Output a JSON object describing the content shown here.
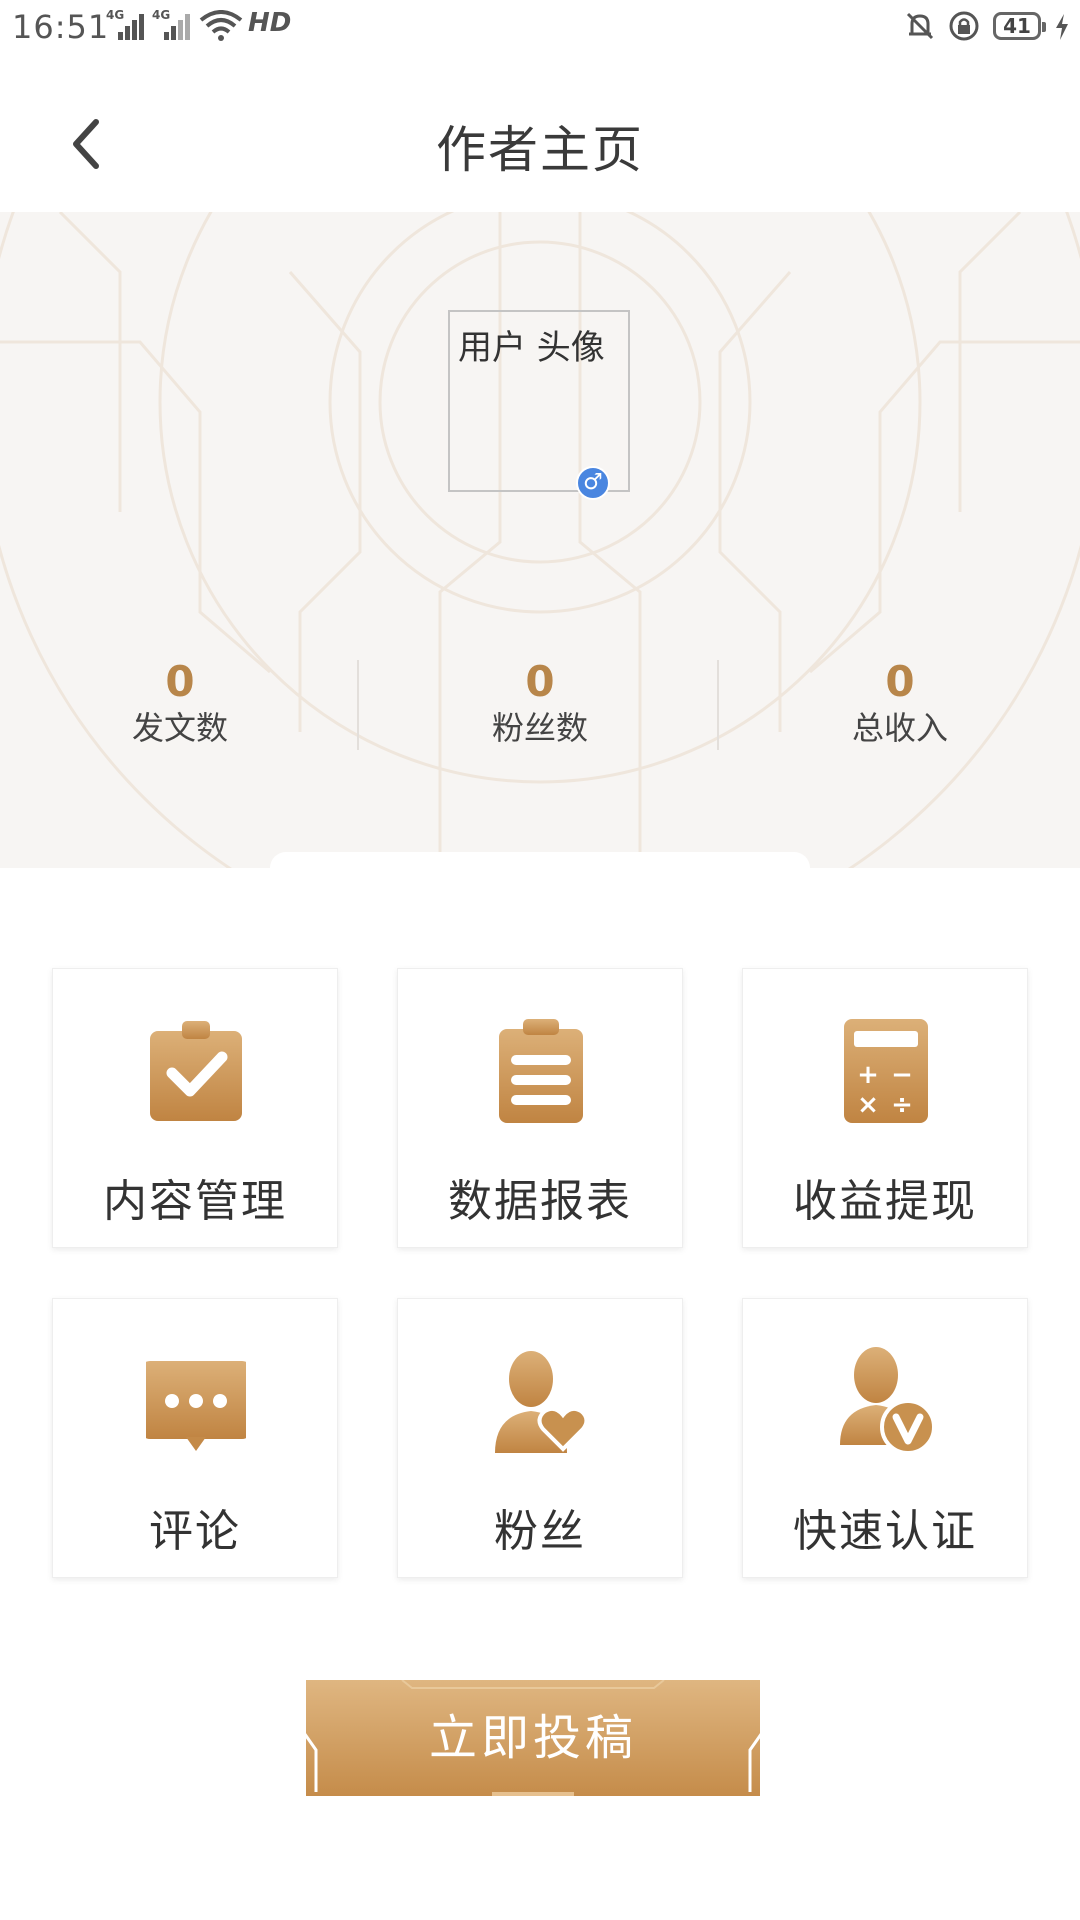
{
  "status_bar": {
    "time": "16:51",
    "signal1_label": "4G",
    "signal2_label": "4G",
    "hd_label": "HD",
    "battery": "41"
  },
  "header": {
    "title": "作者主页"
  },
  "profile": {
    "avatar_alt": "用户 头像",
    "gender_symbol": "♂",
    "stats": [
      {
        "value": "0",
        "label": "发文数"
      },
      {
        "value": "0",
        "label": "粉丝数"
      },
      {
        "value": "0",
        "label": "总收入"
      }
    ]
  },
  "menu": [
    {
      "label": "内容管理",
      "icon": "clipboard-check-icon"
    },
    {
      "label": "数据报表",
      "icon": "report-list-icon"
    },
    {
      "label": "收益提现",
      "icon": "calculator-icon"
    },
    {
      "label": "评论",
      "icon": "comment-bubble-icon"
    },
    {
      "label": "粉丝",
      "icon": "user-heart-icon"
    },
    {
      "label": "快速认证",
      "icon": "user-verified-icon"
    }
  ],
  "submit_label": "立即投稿",
  "colors": {
    "accent": "#c8914f",
    "accent_light": "#dcb078",
    "stat_value": "#b8864a"
  }
}
